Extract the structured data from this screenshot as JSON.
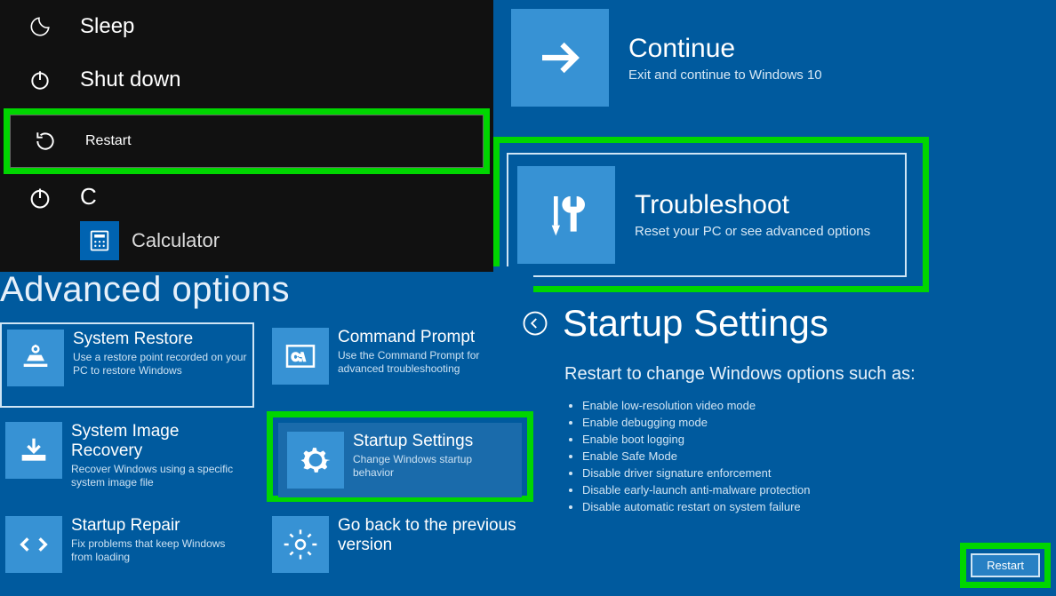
{
  "power_menu": {
    "sleep": "Sleep",
    "shutdown": "Shut down",
    "restart": "Restart",
    "apps_letter": "C",
    "calculator": "Calculator"
  },
  "choose_option": {
    "continue": {
      "title": "Continue",
      "desc": "Exit and continue to Windows 10"
    },
    "troubleshoot": {
      "title": "Troubleshoot",
      "desc": "Reset your PC or see advanced options"
    }
  },
  "advanced": {
    "heading": "Advanced options",
    "tiles": {
      "system_restore": {
        "title": "System Restore",
        "desc": "Use a restore point recorded on your PC to restore Windows"
      },
      "command_prompt": {
        "title": "Command Prompt",
        "desc": "Use the Command Prompt for advanced troubleshooting"
      },
      "image_recovery": {
        "title": "System Image Recovery",
        "desc": "Recover Windows using a specific system image file"
      },
      "startup_settings": {
        "title": "Startup Settings",
        "desc": "Change Windows startup behavior"
      },
      "startup_repair": {
        "title": "Startup Repair",
        "desc": "Fix problems that keep Windows from loading"
      },
      "go_back": {
        "title": "Go back to the previous version",
        "desc": ""
      }
    }
  },
  "startup_settings": {
    "heading": "Startup Settings",
    "subheading": "Restart to change Windows options such as:",
    "bullets": [
      "Enable low-resolution video mode",
      "Enable debugging mode",
      "Enable boot logging",
      "Enable Safe Mode",
      "Disable driver signature enforcement",
      "Disable early-launch anti-malware protection",
      "Disable automatic restart on system failure"
    ],
    "restart_button": "Restart"
  }
}
